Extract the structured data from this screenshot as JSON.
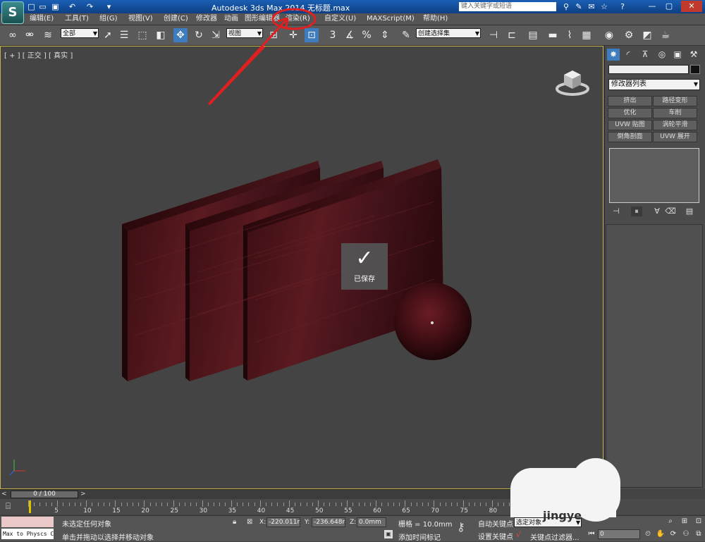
{
  "titlebar": {
    "app_title": "Autodesk 3ds Max 2014    无标题.max",
    "search_placeholder": "键入关键字或短语",
    "logo_icon": "3ds-max-logo-icon"
  },
  "menu": [
    "编辑(E)",
    "工具(T)",
    "组(G)",
    "视图(V)",
    "创建(C)",
    "修改器",
    "动画",
    "图形编辑器",
    "渲染(R)",
    "自定义(U)",
    "MAXScript(M)",
    "帮助(H)"
  ],
  "toolbar": {
    "selection_filter": "全部",
    "reference_coord": "视图",
    "named_selection": "创建选择集"
  },
  "viewport": {
    "label": "[ + ] [ 正交 ] [ 真实 ]",
    "saved_toast": "已保存"
  },
  "command_panel": {
    "modifier_list": "修改器列表",
    "modifier_buttons": [
      "挤出",
      "路径变形",
      "优化",
      "车削",
      "UVW 贴图",
      "涡轮平滑",
      "倒角剖面",
      "UVW 展开"
    ]
  },
  "time_slider": {
    "frame_label": "0 / 100",
    "ticks": [
      5,
      10,
      15,
      20,
      25,
      30,
      35,
      40,
      45,
      50,
      55,
      60,
      65,
      70,
      75,
      80,
      85
    ]
  },
  "status": {
    "maxscript_text": "Max to Physcs C",
    "selection_status": "未选定任何对象",
    "prompt": "单击并拖动以选择并移动对象",
    "x_label": "X:",
    "x_value": "-220.011m",
    "y_label": "Y:",
    "y_value": "-236.648m",
    "z_label": "Z:",
    "z_value": "0.0mm",
    "grid": "栅格 = 10.0mm",
    "add_time_tag": "添加时间标记",
    "auto_key": "自动关键点",
    "selected_object": "选定对象",
    "set_key": "设置关键点",
    "key_filters": "关键点过滤器...",
    "current_frame": "0"
  },
  "annotation": {
    "watermark": "jingye"
  },
  "colors": {
    "annotation_red": "#e02020",
    "viewport_border": "#c2b04a",
    "object_wood": "#4a1318"
  }
}
